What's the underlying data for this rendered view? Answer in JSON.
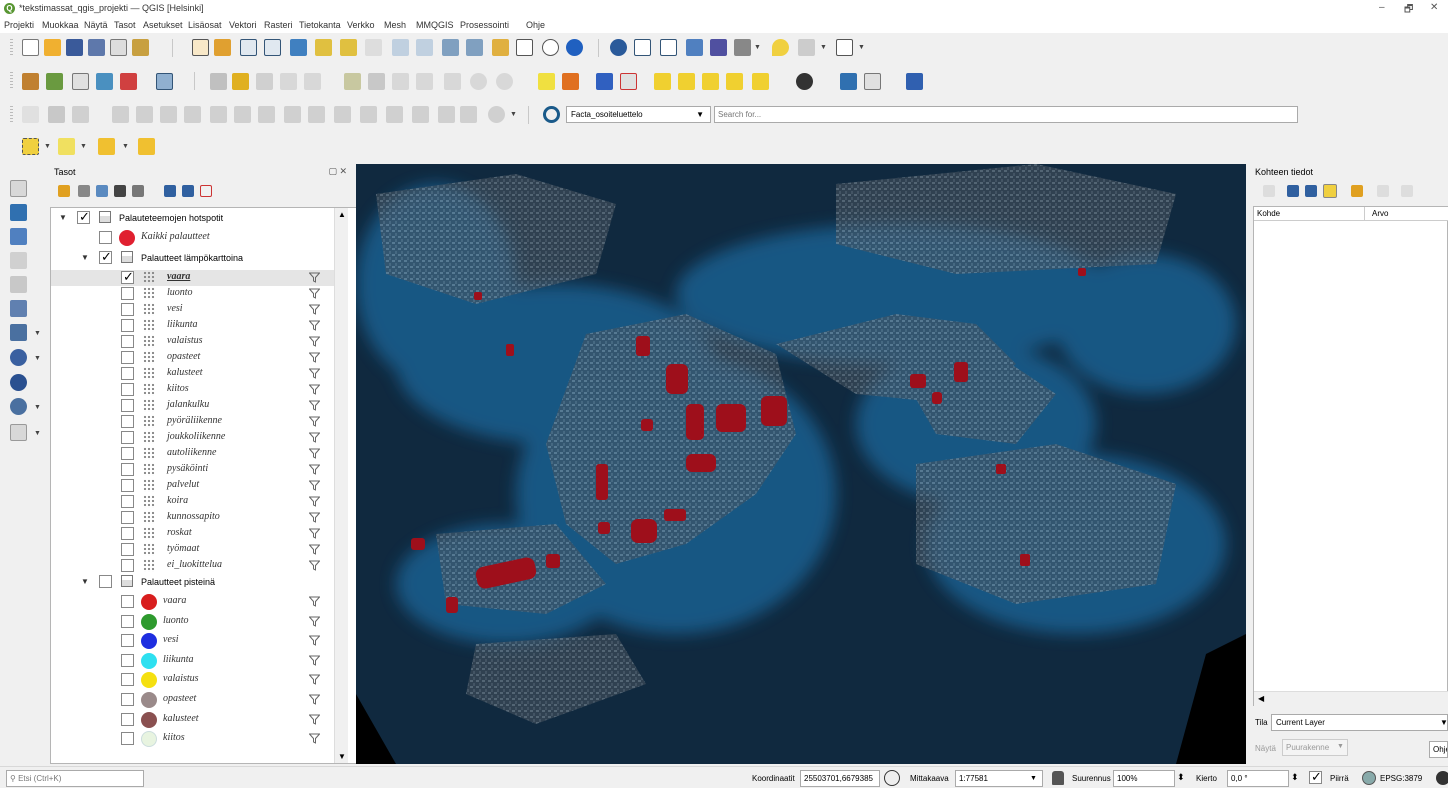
{
  "window": {
    "title": "*tekstimassat_qgis_projekti — QGIS [Helsinki]",
    "minimize": "–",
    "restore": "🗗",
    "close": "✕"
  },
  "menu": [
    "Projekti",
    "Muokkaa",
    "Näytä",
    "Tasot",
    "Asetukset",
    "Lisäosat",
    "Vektori",
    "Rasteri",
    "Tietokanta",
    "Verkko",
    "Mesh",
    "MMQGIS",
    "Prosessointi",
    "Ohje"
  ],
  "locator": {
    "combo_value": "Facta_osoiteluettelo",
    "search_placeholder": "Search for..."
  },
  "layers_panel": {
    "title": "Tasot",
    "controls": "▢ ✕",
    "tree": [
      {
        "kind": "group",
        "level": 0,
        "checked": true,
        "expanded": true,
        "label": "Palauteteemojen hotspotit"
      },
      {
        "kind": "point",
        "level": 1,
        "checked": false,
        "label": "Kaikki palautteet",
        "color": "#e02030"
      },
      {
        "kind": "group",
        "level": 1,
        "checked": true,
        "expanded": true,
        "label": "Palautteet lämpökarttoina"
      },
      {
        "kind": "heat",
        "level": 2,
        "checked": true,
        "label": "vaara",
        "filter": true,
        "selected": true
      },
      {
        "kind": "heat",
        "level": 2,
        "checked": false,
        "label": "luonto",
        "filter": true
      },
      {
        "kind": "heat",
        "level": 2,
        "checked": false,
        "label": "vesi",
        "filter": true
      },
      {
        "kind": "heat",
        "level": 2,
        "checked": false,
        "label": "liikunta",
        "filter": true
      },
      {
        "kind": "heat",
        "level": 2,
        "checked": false,
        "label": "valaistus",
        "filter": true
      },
      {
        "kind": "heat",
        "level": 2,
        "checked": false,
        "label": "opasteet",
        "filter": true
      },
      {
        "kind": "heat",
        "level": 2,
        "checked": false,
        "label": "kalusteet",
        "filter": true
      },
      {
        "kind": "heat",
        "level": 2,
        "checked": false,
        "label": "kiitos",
        "filter": true
      },
      {
        "kind": "heat",
        "level": 2,
        "checked": false,
        "label": "jalankulku",
        "filter": true
      },
      {
        "kind": "heat",
        "level": 2,
        "checked": false,
        "label": "pyöräliikenne",
        "filter": true
      },
      {
        "kind": "heat",
        "level": 2,
        "checked": false,
        "label": "joukkoliikenne",
        "filter": true
      },
      {
        "kind": "heat",
        "level": 2,
        "checked": false,
        "label": "autoliikenne",
        "filter": true
      },
      {
        "kind": "heat",
        "level": 2,
        "checked": false,
        "label": "pysäköinti",
        "filter": true
      },
      {
        "kind": "heat",
        "level": 2,
        "checked": false,
        "label": "palvelut",
        "filter": true
      },
      {
        "kind": "heat",
        "level": 2,
        "checked": false,
        "label": "koira",
        "filter": true
      },
      {
        "kind": "heat",
        "level": 2,
        "checked": false,
        "label": "kunnossapito",
        "filter": true
      },
      {
        "kind": "heat",
        "level": 2,
        "checked": false,
        "label": "roskat",
        "filter": true
      },
      {
        "kind": "heat",
        "level": 2,
        "checked": false,
        "label": "työmaat",
        "filter": true
      },
      {
        "kind": "heat",
        "level": 2,
        "checked": false,
        "label": "ei_luokittelua",
        "filter": true
      },
      {
        "kind": "group",
        "level": 1,
        "checked": false,
        "expanded": true,
        "label": "Palautteet pisteinä"
      },
      {
        "kind": "point",
        "level": 2,
        "checked": false,
        "label": "vaara",
        "color": "#d81e1e",
        "filter": true
      },
      {
        "kind": "point",
        "level": 2,
        "checked": false,
        "label": "luonto",
        "color": "#2e9a2e",
        "filter": true
      },
      {
        "kind": "point",
        "level": 2,
        "checked": false,
        "label": "vesi",
        "color": "#1e2ee0",
        "filter": true
      },
      {
        "kind": "point",
        "level": 2,
        "checked": false,
        "label": "liikunta",
        "color": "#2ee0f0",
        "filter": true
      },
      {
        "kind": "point",
        "level": 2,
        "checked": false,
        "label": "valaistus",
        "color": "#f5e010",
        "filter": true
      },
      {
        "kind": "point",
        "level": 2,
        "checked": false,
        "label": "opasteet",
        "color": "#9a8a8a",
        "filter": true
      },
      {
        "kind": "point",
        "level": 2,
        "checked": false,
        "label": "kalusteet",
        "color": "#8a5050",
        "filter": true
      },
      {
        "kind": "point",
        "level": 2,
        "checked": false,
        "label": "kiitos",
        "color": "#e8f4e0",
        "filter": true
      }
    ]
  },
  "feature_panel": {
    "title": "Kohteen tiedot",
    "col_feature": "Kohde",
    "col_value": "Arvo",
    "mode_label": "Tila",
    "mode_value": "Current Layer",
    "view_label": "Näytä",
    "view_value": "Puurakenne",
    "help_button": "Ohje"
  },
  "status": {
    "locate_placeholder": "Etsi (Ctrl+K)",
    "coord_label": "Koordinaatit",
    "coord_value": "25503701,6679385",
    "scale_label": "Mittakaava",
    "scale_value": "1:77581",
    "magnifier_label": "Suurennus",
    "magnifier_value": "100%",
    "rotation_label": "Kierto",
    "rotation_value": "0,0 °",
    "render_label": "Piirrä",
    "crs_value": "EPSG:3879"
  },
  "colors": {
    "map_water": "#123049",
    "map_land": "#6a7782",
    "hotspot": "#a0101a"
  }
}
